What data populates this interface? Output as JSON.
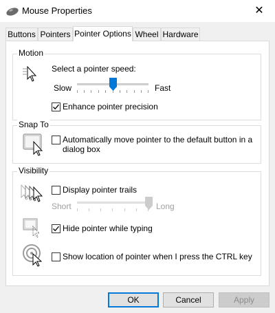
{
  "window": {
    "title": "Mouse Properties",
    "close_glyph": "✕"
  },
  "tabs": [
    {
      "label": "Buttons",
      "active": false
    },
    {
      "label": "Pointers",
      "active": false
    },
    {
      "label": "Pointer Options",
      "active": true
    },
    {
      "label": "Wheel",
      "active": false
    },
    {
      "label": "Hardware",
      "active": false
    }
  ],
  "motion": {
    "group_label": "Motion",
    "speed_label": "Select a pointer speed:",
    "slow_label": "Slow",
    "fast_label": "Fast",
    "speed_level": 0.5,
    "enhance_label": "Enhance pointer precision",
    "enhance_checked": true
  },
  "snap_to": {
    "group_label": "Snap To",
    "auto_move_label_line1": "Automatically move pointer to the default button in a",
    "auto_move_label_line2": "dialog box",
    "auto_move_checked": false
  },
  "visibility": {
    "group_label": "Visibility",
    "trails_label": "Display pointer trails",
    "trails_checked": false,
    "short_label": "Short",
    "long_label": "Long",
    "trail_length_level": 1.0,
    "hide_typing_label": "Hide pointer while typing",
    "hide_typing_checked": true,
    "show_location_label": "Show location of pointer when I press the CTRL key",
    "show_location_checked": false
  },
  "buttons": {
    "ok": "OK",
    "cancel": "Cancel",
    "apply": "Apply"
  },
  "colors": {
    "accent": "#0078d7",
    "disabled_text": "#a0a0a0"
  }
}
